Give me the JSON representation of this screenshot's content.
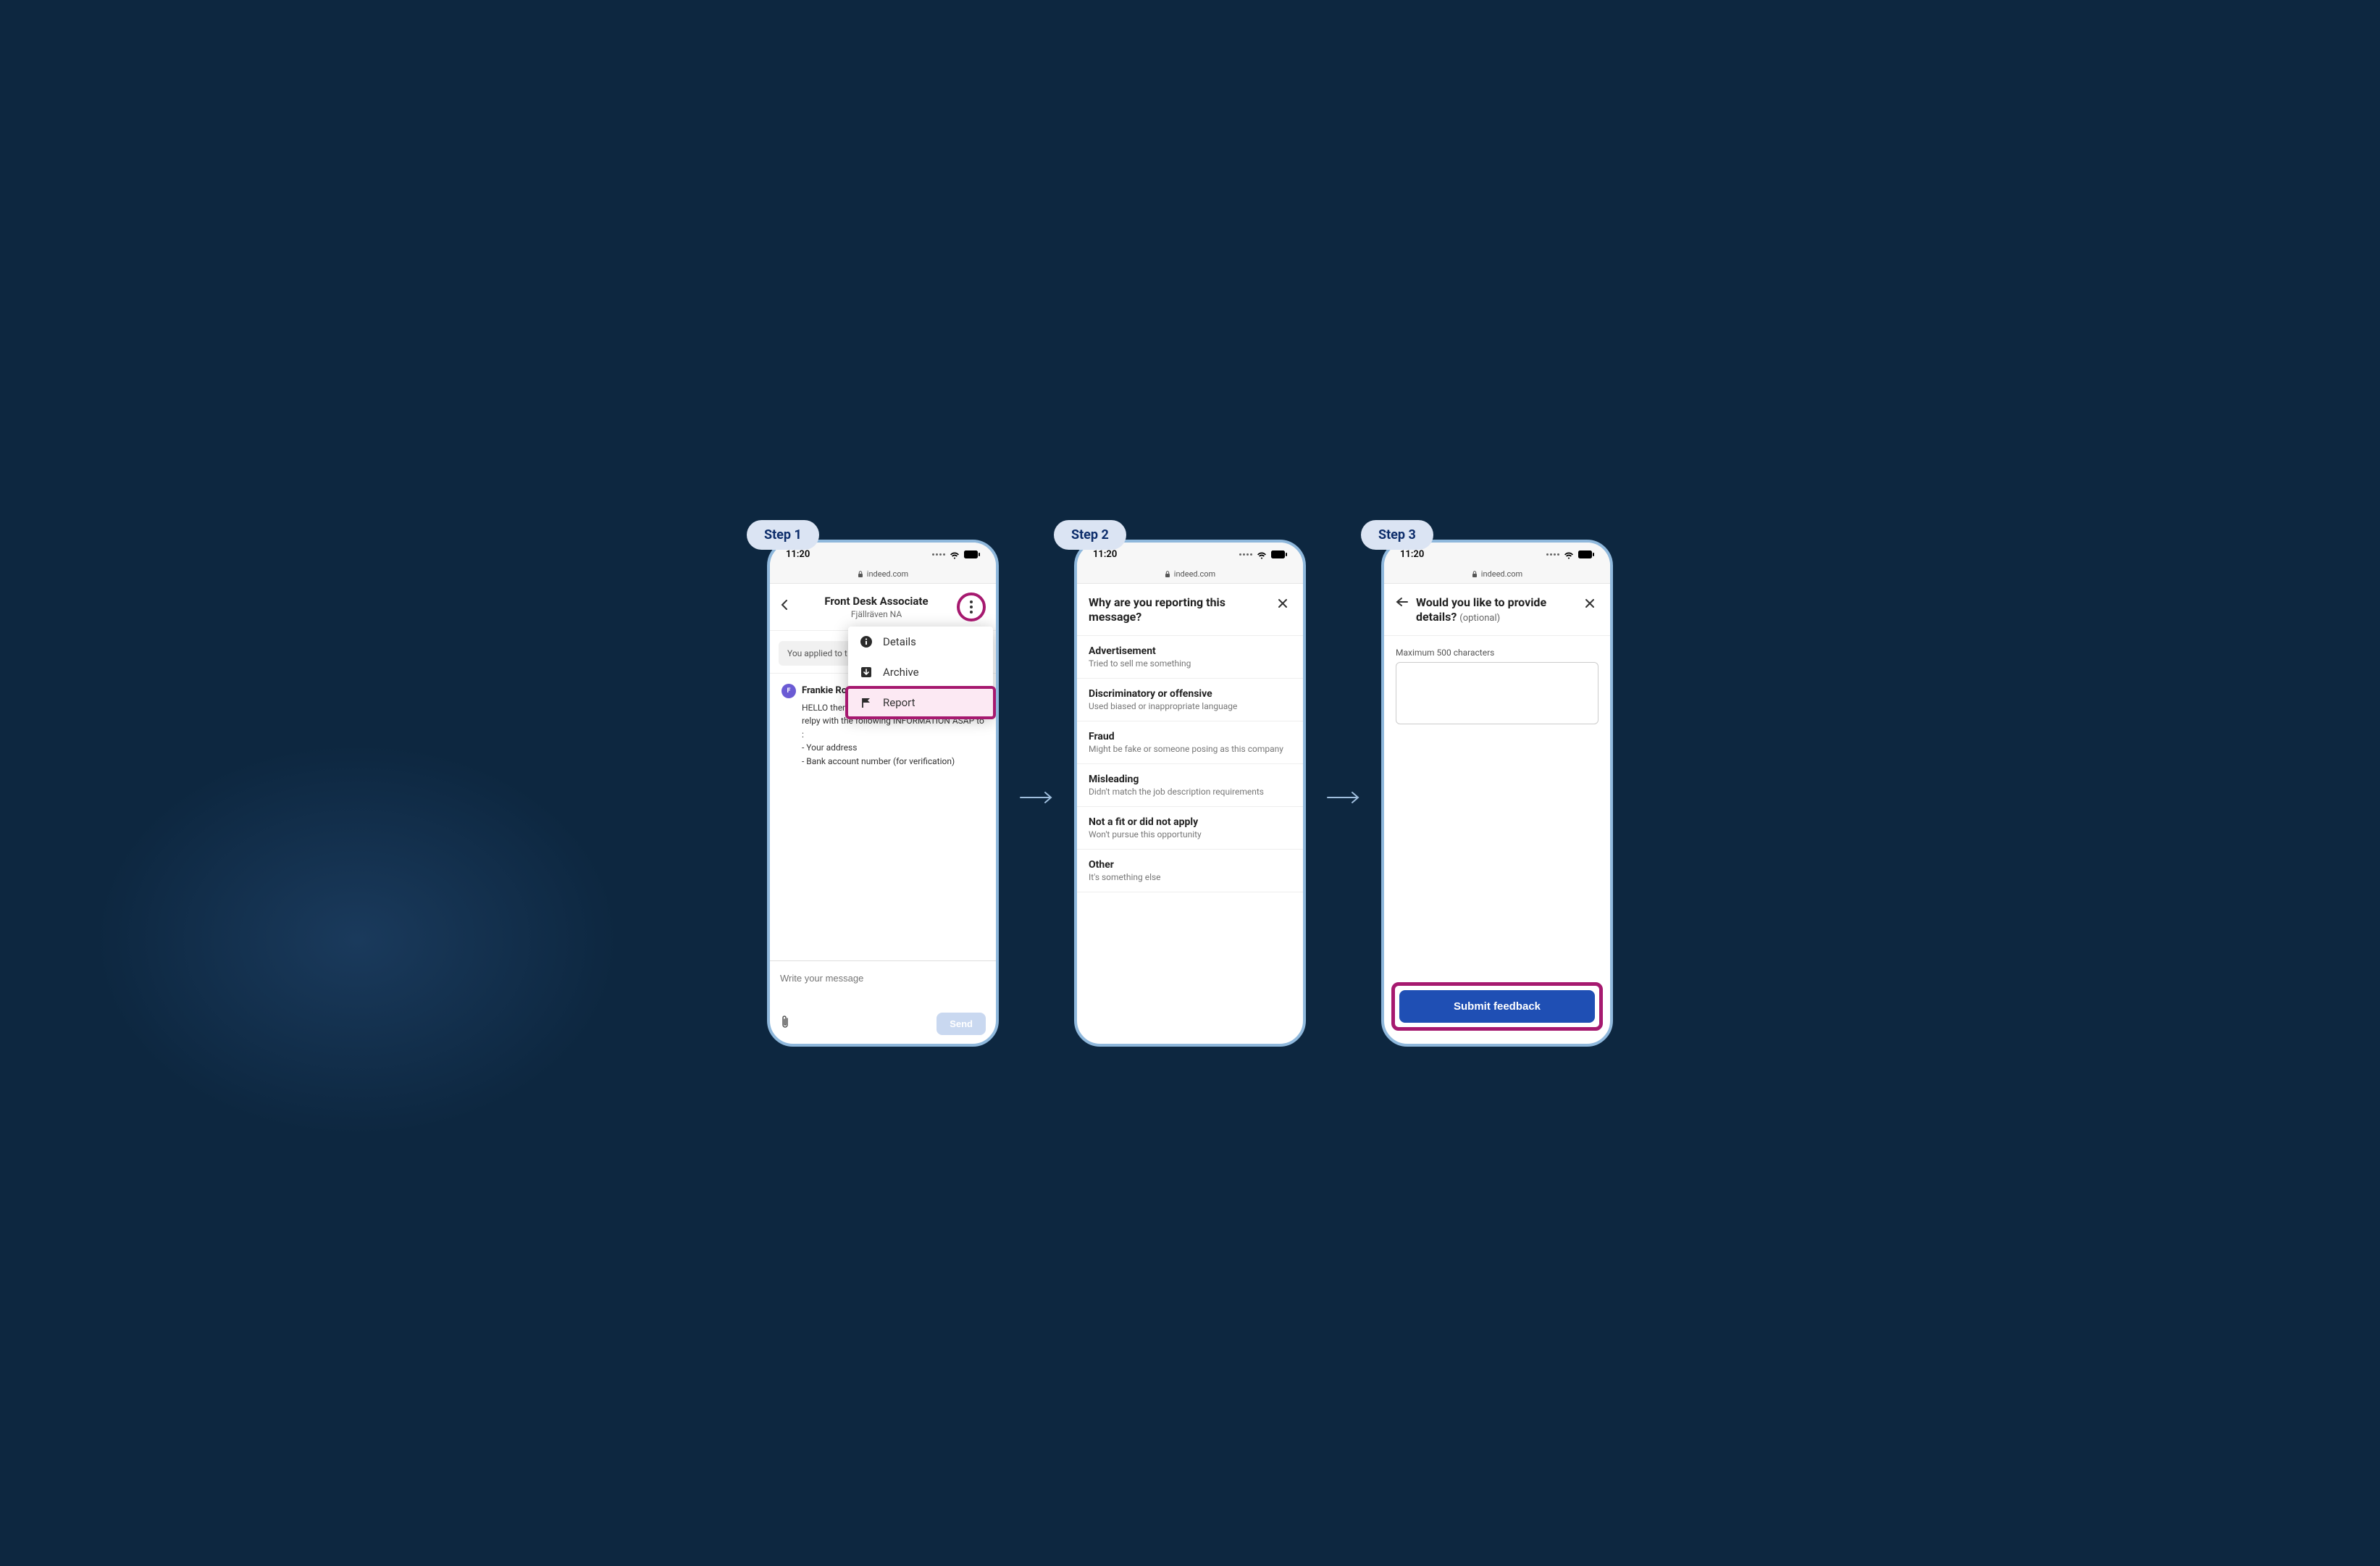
{
  "steps": [
    "Step 1",
    "Step 2",
    "Step 3"
  ],
  "status": {
    "time": "11:20"
  },
  "url": {
    "domain": "indeed.com"
  },
  "panel1": {
    "headerTitle": "Front Desk Associate",
    "headerSub": "Fjällräven NA",
    "appliedBanner": "You applied to t",
    "senderName": "Frankie Ro",
    "messageLine1": "HELLO ther",
    "messageLine2": "relpy with the following INFORMATION ASAP to :",
    "messageLine3": "- Your address",
    "messageLine4": "- Bank account number (for verification)",
    "composePlaceholder": "Write your message",
    "sendLabel": "Send",
    "dropdown": {
      "details": "Details",
      "archive": "Archive",
      "report": "Report"
    }
  },
  "panel2": {
    "title": "Why are you reporting this message?",
    "reasons": [
      {
        "title": "Advertisement",
        "sub": "Tried to sell me something"
      },
      {
        "title": "Discriminatory or offensive",
        "sub": "Used biased or inappropriate language"
      },
      {
        "title": "Fraud",
        "sub": "Might be fake or someone posing as this company"
      },
      {
        "title": "Misleading",
        "sub": "Didn't match the job description requirements"
      },
      {
        "title": "Not a fit or did not apply",
        "sub": "Won't pursue this opportunity"
      },
      {
        "title": "Other",
        "sub": "It's something else"
      }
    ]
  },
  "panel3": {
    "title": "Would you like to provide details?",
    "titleSuffix": "(optional)",
    "fieldLabel": "Maximum 500 characters",
    "submitLabel": "Submit feedback"
  }
}
